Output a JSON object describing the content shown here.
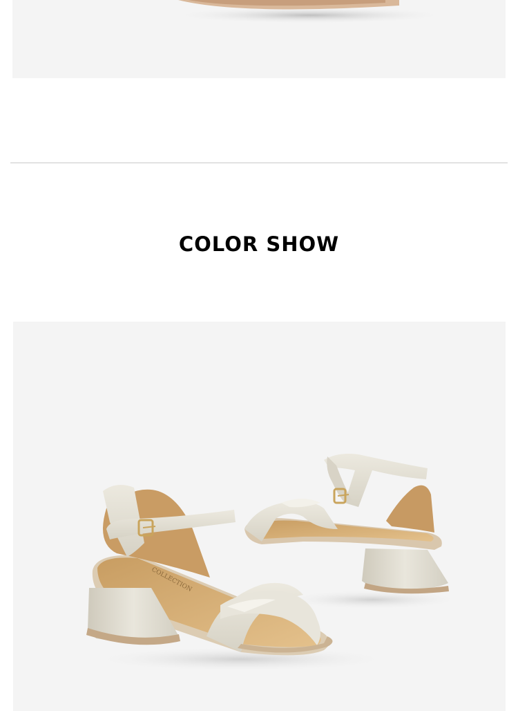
{
  "section": {
    "title": "COLOR SHOW"
  },
  "product": {
    "insole_print": "COLLECTION"
  },
  "colors": {
    "background": "#ffffff",
    "panel": "#f4f4f4",
    "divider": "#c9c9c9",
    "title": "#000000",
    "leather": "#e4e1d6",
    "insole": "#d9b57e",
    "buckle": "#c9a45c"
  }
}
